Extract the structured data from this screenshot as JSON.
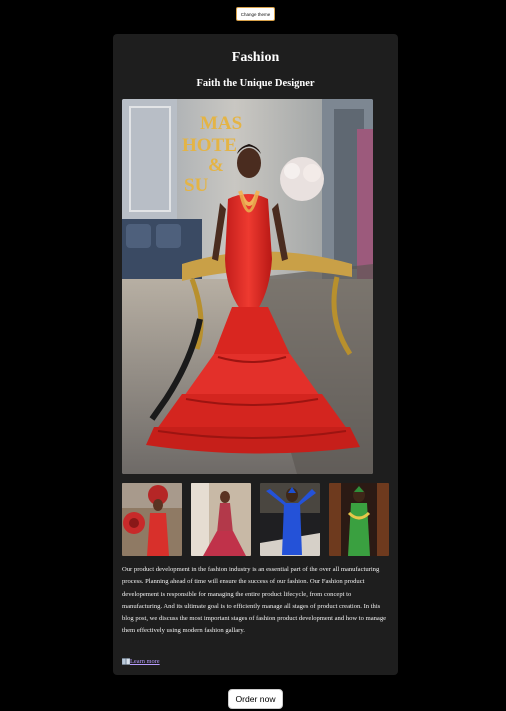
{
  "header": {
    "theme_button_label": "Change theme"
  },
  "card": {
    "title": "Fashion",
    "subtitle": "Faith the Unique Designer",
    "main_photo_sign": "MAS HOTEL & SUITES",
    "body_text": "Our product development in the fashion industry is an essential part of the over all manufacturing process. Planning ahead of time will ensure the success of our fashion. Our Fashion product developement is responsible for managing the entire product lifecycle, from concept to manufacturing. And its ultimate goal is to efficiently manage all stages of product creation. In this blog post, we discuss the most important stages of fashion product development and how to manage them effectively using modern fashion gallary.",
    "learn_more_label": "Learn more"
  },
  "footer": {
    "order_button_label": "Order now"
  },
  "colors": {
    "page_background": "#000000",
    "card_background": "#1e1e1e",
    "link": "#b79cff",
    "dress_red": "#e02a24",
    "theme_button_border": "#d8a24a"
  },
  "icons": {
    "learn_more": "book-icon"
  }
}
